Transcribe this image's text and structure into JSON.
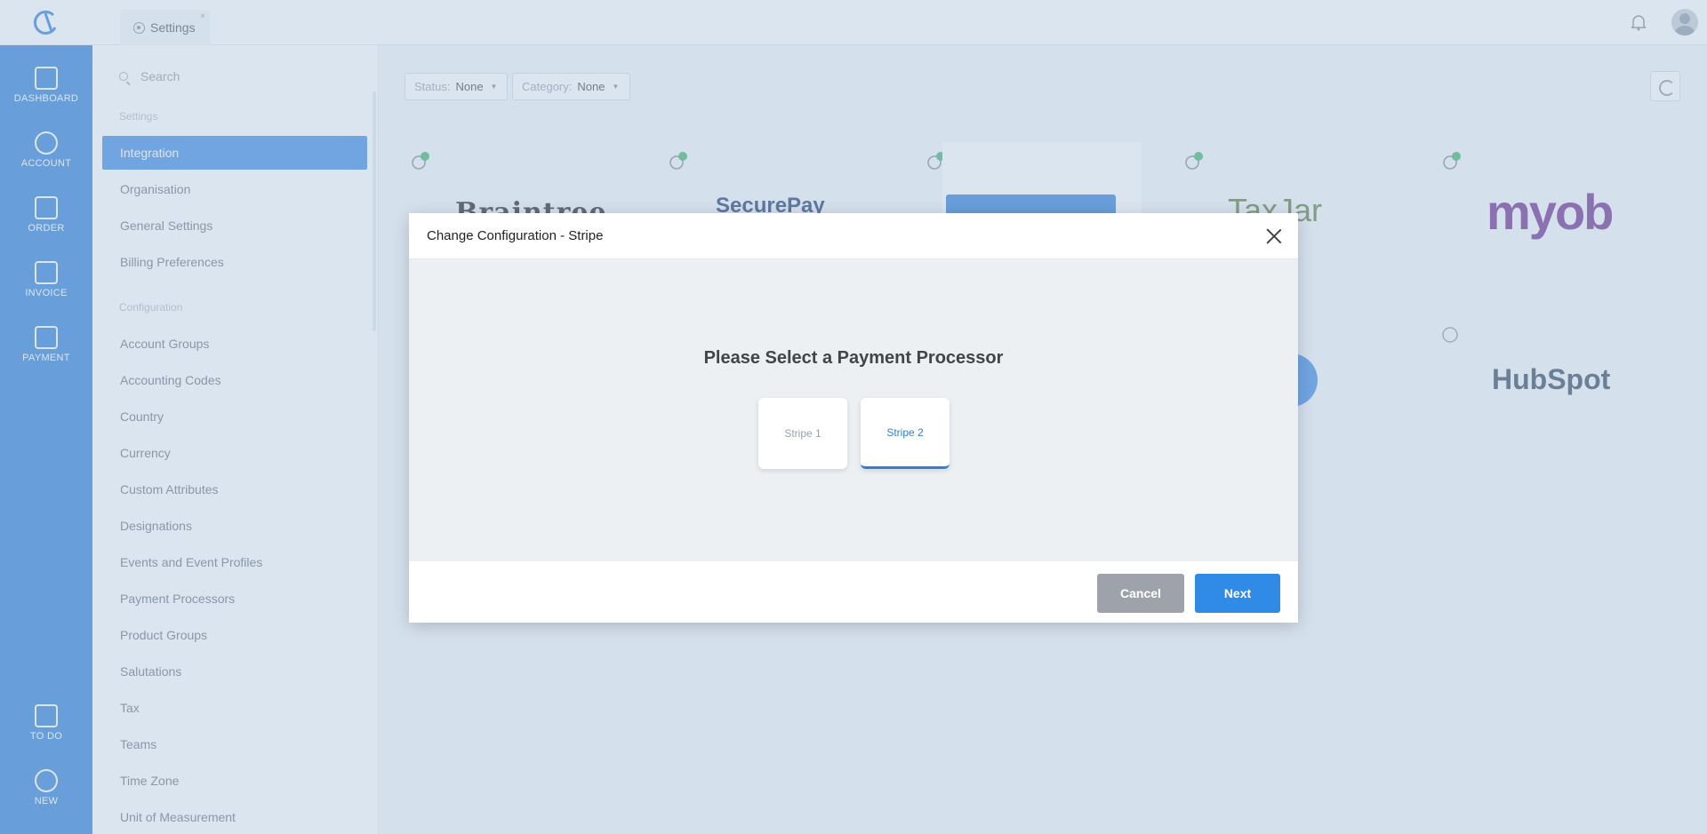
{
  "topbar": {
    "tab_label": "Settings",
    "tab_close": "×"
  },
  "rail": {
    "items": [
      {
        "label": "DASHBOARD"
      },
      {
        "label": "ACCOUNT"
      },
      {
        "label": "ORDER"
      },
      {
        "label": "INVOICE"
      },
      {
        "label": "PAYMENT"
      },
      {
        "label": "TO DO"
      },
      {
        "label": "NEW"
      }
    ]
  },
  "menu": {
    "search_placeholder": "Search",
    "section_settings": "Settings",
    "section_configuration": "Configuration",
    "settings_items": [
      "Integration",
      "Organisation",
      "General Settings",
      "Billing Preferences"
    ],
    "config_items": [
      "Account Groups",
      "Accounting Codes",
      "Country",
      "Currency",
      "Custom Attributes",
      "Designations",
      "Events and Event Profiles",
      "Payment Processors",
      "Product Groups",
      "Salutations",
      "Tax",
      "Teams",
      "Time Zone",
      "Unit of Measurement"
    ]
  },
  "filters": {
    "status_label": "Status:",
    "status_value": "None",
    "category_label": "Category:",
    "category_value": "None"
  },
  "integrations": {
    "braintree": "Braintree",
    "securepay": "SecurePay",
    "taxjar": "TaxJar",
    "myob": "myob",
    "hubspot": "HubSpot"
  },
  "modal": {
    "title": "Change Configuration - Stripe",
    "heading": "Please Select a Payment Processor",
    "options": [
      "Stripe 1",
      "Stripe 2"
    ],
    "selected_option": "Stripe 2",
    "cancel_label": "Cancel",
    "next_label": "Next"
  },
  "colors": {
    "primary": "#2f8be6",
    "cancel": "#9ea3ab"
  }
}
